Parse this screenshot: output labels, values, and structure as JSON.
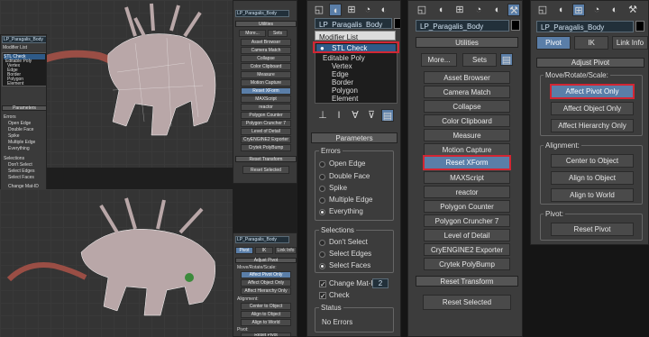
{
  "object_name": "LP_Paragalis_Body",
  "modifier_list_label": "Modifier List",
  "stack": [
    {
      "label": "STL Check",
      "icon": "lightbulb"
    },
    {
      "label": "Editable Poly"
    },
    {
      "label": "Vertex"
    },
    {
      "label": "Edge"
    },
    {
      "label": "Border"
    },
    {
      "label": "Polygon"
    },
    {
      "label": "Element"
    }
  ],
  "stl_check": {
    "rollout": "Parameters",
    "errors_label": "Errors",
    "errors": [
      "Open Edge",
      "Double Face",
      "Spike",
      "Multiple Edge",
      "Everything"
    ],
    "errors_selected": "Everything",
    "selections_label": "Selections",
    "selections": [
      "Don't Select",
      "Select Edges",
      "Select Faces"
    ],
    "selections_selected": "Select Faces",
    "change_mat_id_label": "Change Mat-ID",
    "change_mat_id_value": "2",
    "check_label": "Check",
    "status_label": "Status",
    "status_value": "No Errors"
  },
  "utilities": {
    "rollout": "Utilities",
    "more": "More...",
    "sets": "Sets",
    "items": [
      "Asset Browser",
      "Camera Match",
      "Collapse",
      "Color Clipboard",
      "Measure",
      "Motion Capture",
      "Reset XForm",
      "MAXScript",
      "reactor",
      "Polygon Counter",
      "Polygon Cruncher 7",
      "Level of Detail",
      "CryENGINE2 Exporter",
      "Crytek PolyBump"
    ],
    "highlighted": "Reset XForm",
    "reset_rollout": "Reset Transform",
    "reset_selected": "Reset Selected"
  },
  "hierarchy": {
    "tabs": [
      "Pivot",
      "IK",
      "Link Info"
    ],
    "active_tab": "Pivot",
    "rollout": "Adjust Pivot",
    "move_label": "Move/Rotate/Scale:",
    "move_buttons": [
      "Affect Pivot Only",
      "Affect Object Only",
      "Affect Hierarchy Only"
    ],
    "highlighted": "Affect Pivot Only",
    "alignment_label": "Alignment:",
    "alignment_buttons": [
      "Center to Object",
      "Align to Object",
      "Align to World"
    ],
    "pivot_label": "Pivot:",
    "reset_pivot": "Reset Pivot"
  },
  "colors": {
    "accent": "#5a7ea8",
    "highlight_box": "#d22633",
    "creature": "#b9a7a8",
    "tail": "#9a4e45"
  }
}
